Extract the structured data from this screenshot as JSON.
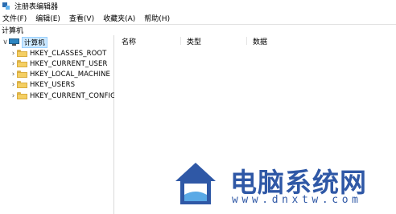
{
  "window": {
    "title": "注册表编辑器",
    "icon": "regedit-icon"
  },
  "menubar": {
    "items": [
      "文件(F)",
      "编辑(E)",
      "查看(V)",
      "收藏夹(A)",
      "帮助(H)"
    ]
  },
  "address": {
    "path": "计算机"
  },
  "tree": {
    "root": {
      "label": "计算机",
      "icon": "computer-icon",
      "expanded": true
    },
    "children": [
      {
        "label": "HKEY_CLASSES_ROOT",
        "icon": "folder-icon"
      },
      {
        "label": "HKEY_CURRENT_USER",
        "icon": "folder-icon"
      },
      {
        "label": "HKEY_LOCAL_MACHINE",
        "icon": "folder-icon"
      },
      {
        "label": "HKEY_USERS",
        "icon": "folder-icon"
      },
      {
        "label": "HKEY_CURRENT_CONFIG",
        "icon": "folder-icon"
      }
    ]
  },
  "list": {
    "columns": [
      "名称",
      "类型",
      "数据"
    ]
  },
  "watermark": {
    "title": "电脑系统网",
    "url": "www.dnxtw.com",
    "color": "#2f58a6",
    "accent": "#5aa9e6"
  }
}
